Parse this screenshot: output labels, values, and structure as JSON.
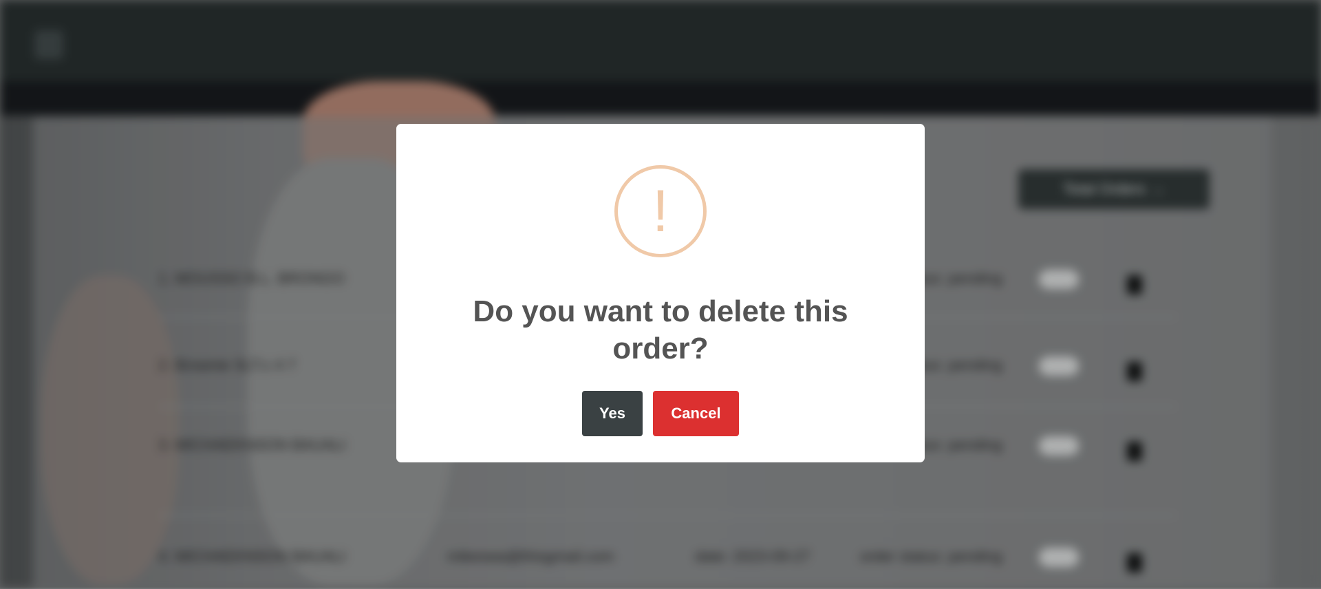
{
  "background": {
    "orders_button_label": "Total Orders →",
    "orders": [
      {
        "name": "1. MOUSSO B.L. BRONGO",
        "email": "",
        "date": "",
        "status": "order status: pending"
      },
      {
        "name": "2. Brownie SLT.c 4 7",
        "email": "",
        "date": "",
        "status": "order status: pending"
      },
      {
        "name": "3. MICHAEKNSON BAUALI",
        "email": "",
        "date": "",
        "status": "order status: pending"
      },
      {
        "name": "4. MICHAEKNSON BAUALI",
        "email": "mikeswa@thisgmail.com",
        "date": "date: 2023-09-27",
        "status": "order status: pending"
      }
    ]
  },
  "modal": {
    "icon": "warning-exclamation-icon",
    "icon_glyph": "!",
    "icon_color": "#f0c9a8",
    "title": "Do you want to delete this order?",
    "confirm_label": "Yes",
    "cancel_label": "Cancel",
    "confirm_color": "#3a4143",
    "cancel_color": "#dc3030"
  }
}
